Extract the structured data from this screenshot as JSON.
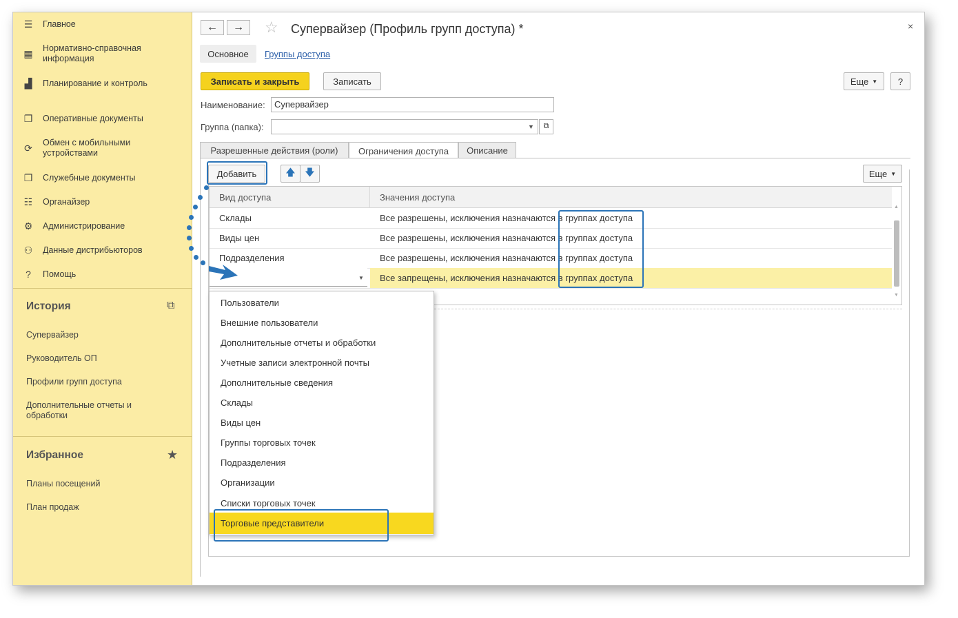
{
  "sidebar": {
    "nav": [
      {
        "icon": "menu-icon",
        "glyph": "☰",
        "label": "Главное"
      },
      {
        "icon": "reference-icon",
        "glyph": "▦",
        "label": "Нормативно-справочная информация"
      },
      {
        "icon": "chart-icon",
        "glyph": "▟",
        "label": "Планирование и контроль"
      },
      {
        "icon": "documents-icon",
        "glyph": "❐",
        "label": "Оперативные документы"
      },
      {
        "icon": "sync-icon",
        "glyph": "⟳",
        "label": "Обмен с мобильными устройствами"
      },
      {
        "icon": "service-docs-icon",
        "glyph": "❐",
        "label": "Служебные документы"
      },
      {
        "icon": "organizer-icon",
        "glyph": "☷",
        "label": "Органайзер"
      },
      {
        "icon": "gear-icon",
        "glyph": "⚙",
        "label": "Администрирование"
      },
      {
        "icon": "distributor-icon",
        "glyph": "⚇",
        "label": "Данные дистрибьюторов"
      },
      {
        "icon": "help-icon",
        "glyph": "?",
        "label": "Помощь"
      }
    ],
    "history": {
      "title": "История",
      "items": [
        "Супервайзер",
        "Руководитель ОП",
        "Профили групп доступа",
        "Дополнительные отчеты и обработки"
      ]
    },
    "favorites": {
      "title": "Избранное",
      "items": [
        "Планы посещений",
        "План продаж"
      ]
    }
  },
  "header": {
    "back_glyph": "🡐",
    "forward_glyph": "🡒",
    "star_glyph": "☆",
    "title": "Супервайзер (Профиль групп доступа) *",
    "close_glyph": "×",
    "subtabs": {
      "main": "Основное",
      "link": "Группы доступа"
    }
  },
  "toolbar": {
    "save_close": "Записать и закрыть",
    "save": "Записать",
    "more": "Еще",
    "help": "?"
  },
  "form": {
    "name_label": "Наименование:",
    "name_value": "Супервайзер",
    "group_label": "Группа (папка):",
    "group_value": ""
  },
  "tabs": [
    "Разрешенные действия (роли)",
    "Ограничения доступа",
    "Описание"
  ],
  "grid_toolbar": {
    "add": "Добавить",
    "more": "Еще"
  },
  "grid": {
    "columns": [
      "Вид доступа",
      "Значения доступа"
    ],
    "rows": [
      {
        "kind": "Склады",
        "value": "Все разрешены, исключения назначаются в группах доступа"
      },
      {
        "kind": "Виды цен",
        "value": "Все разрешены, исключения назначаются в группах доступа"
      },
      {
        "kind": "Подразделения",
        "value": "Все разрешены, исключения назначаются в группах доступа"
      },
      {
        "kind": "",
        "value": "Все запрещены, исключения назначаются в группах доступа"
      }
    ]
  },
  "dropdown": {
    "items": [
      "Пользователи",
      "Внешние пользователи",
      "Дополнительные отчеты и обработки",
      "Учетные записи электронной почты",
      "Дополнительные сведения",
      "Склады",
      "Виды цен",
      "Группы торговых точек",
      "Подразделения",
      "Организации",
      "Списки торговых точек",
      "Торговые представители"
    ],
    "selected": "Торговые представители"
  },
  "colors": {
    "accent": "#f5d21e",
    "sidebar": "#fbeca5",
    "highlight": "#2b74b8"
  }
}
